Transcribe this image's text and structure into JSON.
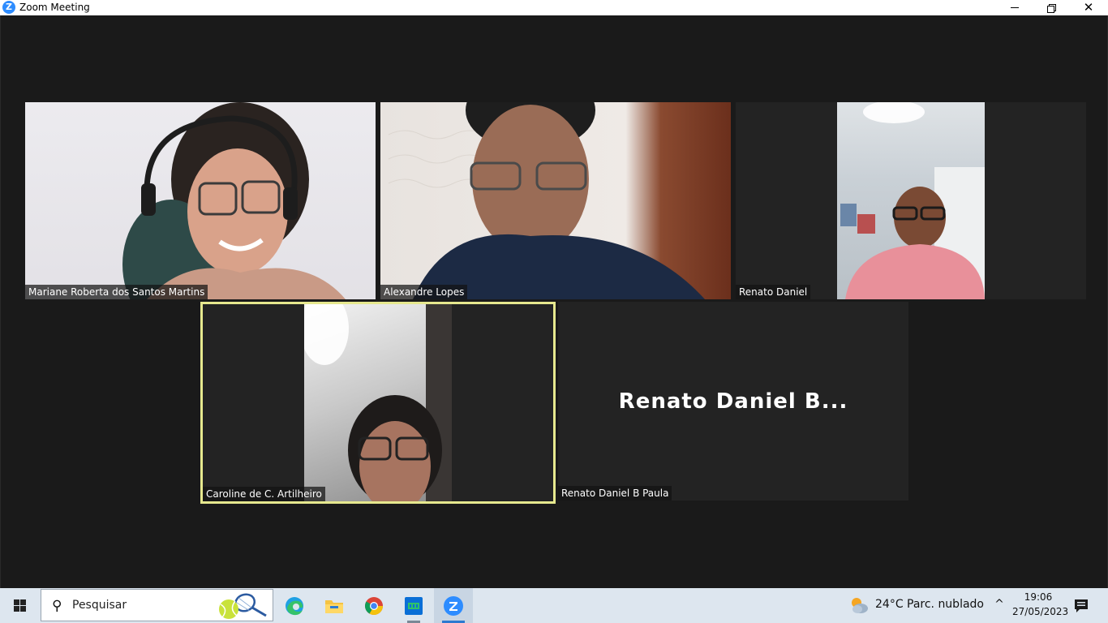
{
  "window": {
    "title": "Zoom Meeting",
    "logo_glyph": "Z",
    "controls": [
      "minimize-icon",
      "restore-icon",
      "close-icon"
    ],
    "close_glyph": "✕"
  },
  "participants": [
    {
      "name": "Mariane Roberta dos Santos Martins",
      "video": true
    },
    {
      "name": "Alexandre Lopes",
      "video": true
    },
    {
      "name": "Renato Daniel",
      "video": true
    },
    {
      "name": "Caroline de C. Artilheiro",
      "video": true,
      "active_speaker": true
    },
    {
      "name": "Renato Daniel B Paula",
      "video": false,
      "display_text": "Renato  Daniel  B..."
    }
  ],
  "colors": {
    "active_speaker_border": "#e6e88e",
    "meeting_bg": "#1a1a1a",
    "tile_bg": "#232323",
    "taskbar_bg": "#dde6ef",
    "zoom_blue": "#2d8cff"
  },
  "taskbar": {
    "search_placeholder": "Pesquisar",
    "search_glyph": "⚲",
    "apps": [
      "edge-icon",
      "file-explorer-icon",
      "chrome-icon",
      "app-icon",
      "zoom-icon"
    ],
    "weather": {
      "temp": "24°C",
      "desc": "Parc. nublado"
    },
    "chevron_glyph": "^",
    "clock": {
      "time": "19:06",
      "date": "27/05/2023"
    }
  }
}
